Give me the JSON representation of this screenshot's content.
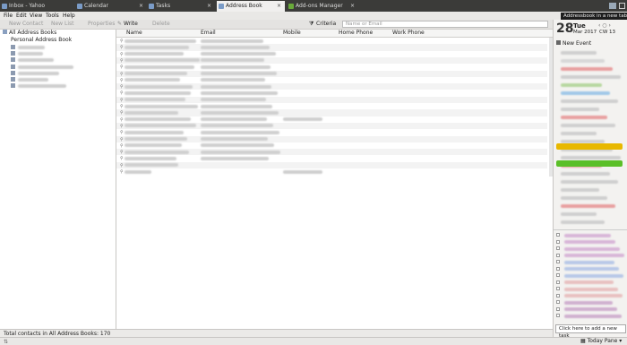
{
  "tabs": [
    {
      "label": "Inbox - Yahoo",
      "active": false
    },
    {
      "label": "Calendar",
      "active": false
    },
    {
      "label": "Tasks",
      "active": false
    },
    {
      "label": "Address Book",
      "active": true
    },
    {
      "label": "Add-ons Manager",
      "active": false
    }
  ],
  "tab_close": "×",
  "menu": [
    "File",
    "Edit",
    "View",
    "Tools",
    "Help"
  ],
  "toolbar": {
    "new_contact": "New Contact",
    "new_list": "New List",
    "properties": "Properties",
    "write": "Write",
    "delete": "Delete",
    "criteria": "Criteria",
    "search_placeholder": "Name or Email"
  },
  "tree": {
    "all": "All Address Books",
    "personal": "Personal Address Book"
  },
  "columns": [
    "Name",
    "Email",
    "Mobile",
    "Home Phone",
    "Work Phone"
  ],
  "status": "Total contacts in All Address Books: 170",
  "today_pane": {
    "tooltip": "Addressbook in a new tab",
    "day_num": "28",
    "weekday": "Tue",
    "month_year": "Mar 2017",
    "cw": "CW 13",
    "events_label": "Ev",
    "new_event": "New Event",
    "add_task": "Click here to add a new task",
    "today_pane_label": "Today Pane"
  },
  "colors": {
    "accent_yellow": "#e8b800",
    "accent_green": "#5bbf28",
    "tab_bg": "#3b3b39"
  }
}
